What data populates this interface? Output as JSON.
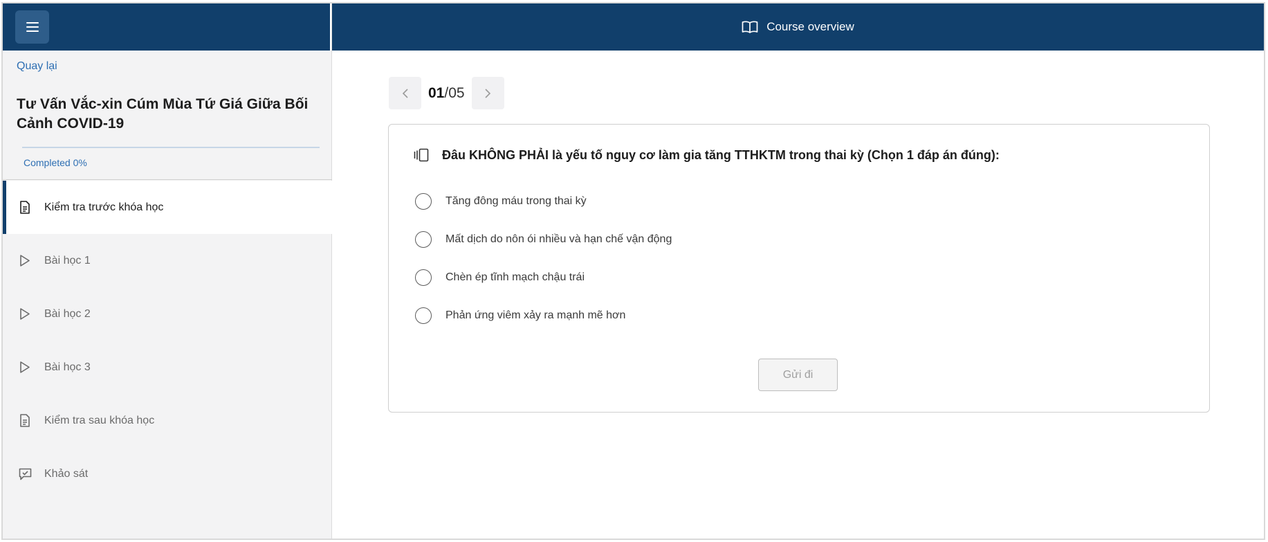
{
  "sidebar": {
    "menu_icon": "hamburger-icon",
    "back_label": "Quay lại",
    "course_title": "Tư Vấn Vắc-xin Cúm Mùa Tứ Giá Giữa Bối Cảnh COVID-19",
    "progress_label": "Completed 0%",
    "progress_percent": 0,
    "items": [
      {
        "label": "Kiểm tra trước khóa học",
        "icon": "document-icon",
        "active": true
      },
      {
        "label": "Bài học 1",
        "icon": "play-icon",
        "active": false
      },
      {
        "label": "Bài học 2",
        "icon": "play-icon",
        "active": false
      },
      {
        "label": "Bài học 3",
        "icon": "play-icon",
        "active": false
      },
      {
        "label": "Kiểm tra sau khóa học",
        "icon": "document-icon",
        "active": false
      },
      {
        "label": "Khảo sát",
        "icon": "survey-icon",
        "active": false
      }
    ]
  },
  "header": {
    "icon": "book-icon",
    "title": "Course overview"
  },
  "quiz": {
    "current": "01",
    "total": "/05",
    "question_icon": "cards-icon",
    "question": "Đâu KHÔNG PHẢI là yếu tố nguy cơ làm gia tăng TTHKTM trong thai kỳ (Chọn 1 đáp án đúng):",
    "options": [
      "Tăng đông máu trong thai kỳ",
      "Mất dịch do nôn ói nhiều và hạn chế vận động",
      "Chèn ép tĩnh mạch chậu trái",
      "Phản ứng viêm xảy ra mạnh mẽ hơn"
    ],
    "submit_label": "Gửi đi"
  },
  "colors": {
    "brand_navy": "#113f6b",
    "link_blue": "#2e6fb3",
    "sidebar_bg": "#f3f3f4"
  }
}
